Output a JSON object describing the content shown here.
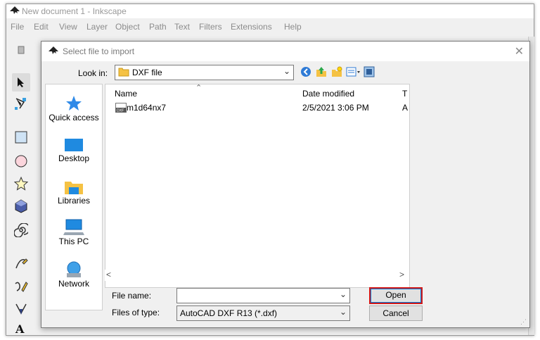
{
  "app": {
    "title": "New document 1 - Inkscape"
  },
  "menu": [
    "File",
    "Edit",
    "View",
    "Layer",
    "Object",
    "Path",
    "Text",
    "Filters",
    "Extensions",
    "Help"
  ],
  "dialog": {
    "title": "Select file to import",
    "look_in_label": "Look in:",
    "look_in_value": "DXF file",
    "places": [
      {
        "label": "Quick access",
        "icon": "star-icon"
      },
      {
        "label": "Desktop",
        "icon": "desktop-icon"
      },
      {
        "label": "Libraries",
        "icon": "libraries-icon"
      },
      {
        "label": "This PC",
        "icon": "computer-icon"
      },
      {
        "label": "Network",
        "icon": "network-icon"
      }
    ],
    "columns": {
      "name": "Name",
      "date": "Date modified",
      "type": "T"
    },
    "files": [
      {
        "name": "m1d64nx7",
        "date": "2/5/2021 3:06 PM",
        "type": "A",
        "icon": "dxf-file-icon"
      }
    ],
    "file_name_label": "File name:",
    "file_name_value": "",
    "file_type_label": "Files of type:",
    "file_type_value": "AutoCAD DXF R13 (*.dxf)",
    "open_label": "Open",
    "cancel_label": "Cancel"
  },
  "colors": {
    "highlight": "#d11a1a",
    "accent": "#0078d7"
  }
}
